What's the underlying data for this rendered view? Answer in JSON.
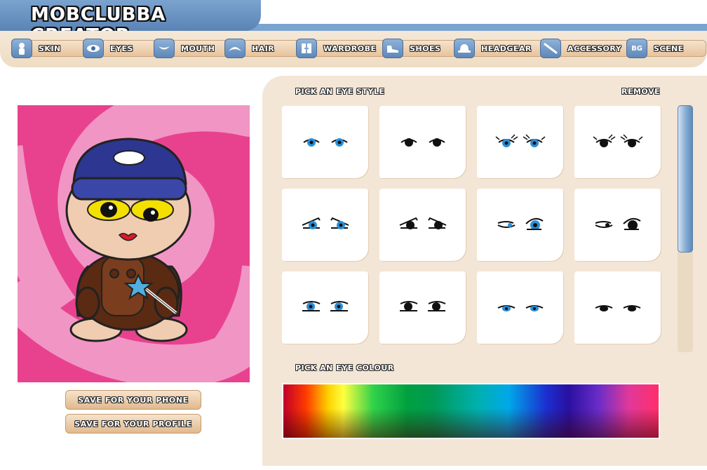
{
  "app": {
    "title": "MOBCLUBBA CREATOR"
  },
  "nav": [
    {
      "label": "SKIN",
      "icon": "person-icon"
    },
    {
      "label": "EYES",
      "icon": "eye-icon"
    },
    {
      "label": "MOUTH",
      "icon": "mouth-icon"
    },
    {
      "label": "HAIR",
      "icon": "hair-icon"
    },
    {
      "label": "WARDROBE",
      "icon": "wardrobe-icon"
    },
    {
      "label": "SHOES",
      "icon": "shoe-icon"
    },
    {
      "label": "HEADGEAR",
      "icon": "hat-icon"
    },
    {
      "label": "ACCESSORY",
      "icon": "wand-icon"
    },
    {
      "label": "SCENE",
      "icon": "bg-icon",
      "icon_text": "BG"
    }
  ],
  "actions": {
    "save_phone": "SAVE FOR YOUR PHONE",
    "save_profile": "SAVE FOR YOUR PROFILE"
  },
  "panel": {
    "eye_style_label": "PICK AN EYE STYLE",
    "remove_label": "REMOVE",
    "eye_colour_label": "PICK AN EYE COLOUR"
  },
  "eye_styles": [
    {
      "style": "round",
      "color": "#2a8fd8"
    },
    {
      "style": "round",
      "color": "#111111"
    },
    {
      "style": "lash",
      "color": "#2a8fd8"
    },
    {
      "style": "lash",
      "color": "#111111"
    },
    {
      "style": "angry",
      "color": "#2a8fd8"
    },
    {
      "style": "angry",
      "color": "#111111"
    },
    {
      "style": "wink",
      "color": "#2a8fd8"
    },
    {
      "style": "wink",
      "color": "#111111"
    },
    {
      "style": "sleepy",
      "color": "#2a8fd8"
    },
    {
      "style": "sleepy",
      "color": "#111111"
    },
    {
      "style": "narrow",
      "color": "#2a8fd8"
    },
    {
      "style": "narrow",
      "color": "#111111"
    }
  ],
  "colors": {
    "scene_bg": "#e8428f",
    "scene_swirl": "#f195c4",
    "accent_blue": "#5e89b8",
    "panel_bg": "#f3e6d6"
  }
}
